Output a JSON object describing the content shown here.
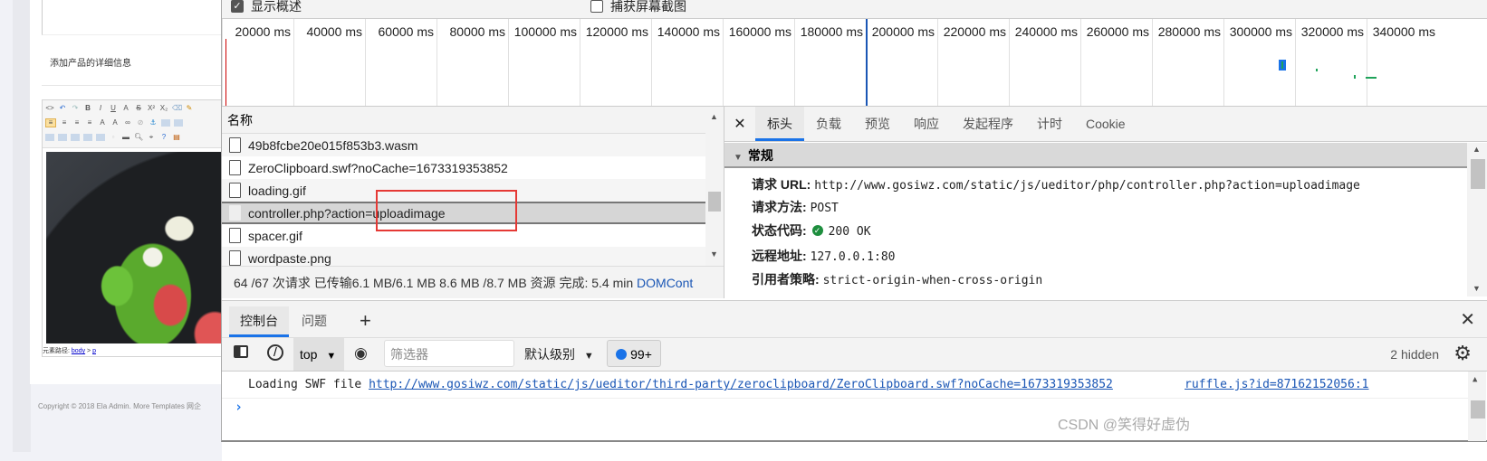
{
  "page": {
    "field_label": "添加产品的详细信息",
    "element_path_label": "元素路径:",
    "element_path_body": "body",
    "element_path_sep": ">",
    "element_path_p": "p",
    "copyright": "Copyright © 2018 Ela Admin. More Templates 网企"
  },
  "devtools": {
    "options": {
      "show_overview": {
        "label": "显示概述",
        "checked": true
      },
      "capture_screenshots": {
        "label": "捕获屏幕截图",
        "checked": false
      }
    },
    "timeline_ticks": [
      "20000 ms",
      "40000 ms",
      "60000 ms",
      "80000 ms",
      "100000 ms",
      "120000 ms",
      "140000 ms",
      "160000 ms",
      "180000 ms",
      "200000 ms",
      "220000 ms",
      "240000 ms",
      "260000 ms",
      "280000 ms",
      "300000 ms",
      "320000 ms",
      "340000 ms"
    ],
    "request_list": {
      "header": "名称",
      "rows": [
        {
          "name": "49b8fcbe20e015f853b3.wasm",
          "selected": false
        },
        {
          "name": "ZeroClipboard.swf?noCache=1673319353852",
          "selected": false
        },
        {
          "name": "loading.gif",
          "selected": false
        },
        {
          "name": "controller.php?action=uploadimage",
          "selected": true
        },
        {
          "name": "spacer.gif",
          "selected": false
        },
        {
          "name": "wordpaste.png",
          "selected": false
        }
      ],
      "summary": "64 /67 次请求  已传输6.1 MB/6.1 MB  8.6 MB /8.7 MB 资源  完成: 5.4 min",
      "summary_link": "DOMCont"
    },
    "detail_tabs": [
      "标头",
      "负载",
      "预览",
      "响应",
      "发起程序",
      "计时",
      "Cookie"
    ],
    "active_detail_tab": "标头",
    "general": {
      "section_title": "常规",
      "request_url_label": "请求 URL:",
      "request_url": "http://www.gosiwz.com/static/js/ueditor/php/controller.php?action=uploadimage",
      "method_label": "请求方法:",
      "method": "POST",
      "status_label": "状态代码:",
      "status": "200 OK",
      "remote_label": "远程地址:",
      "remote": "127.0.0.1:80",
      "referrer_label": "引用者策略:",
      "referrer": "strict-origin-when-cross-origin"
    },
    "drawer": {
      "tabs": [
        "控制台",
        "问题"
      ],
      "add_tab": "+",
      "context": "top",
      "filter_placeholder": "筛选器",
      "level": "默认级别",
      "issues_count": "99+",
      "hidden": "2 hidden",
      "message_prefix": "Loading SWF file",
      "message_link": "http://www.gosiwz.com/static/js/ueditor/third-party/zeroclipboard/ZeroClipboard.swf?noCache=1673319353852",
      "message_source": "ruffle.js?id=87162152056:1"
    }
  },
  "watermark": "CSDN @笑得好虚伪"
}
